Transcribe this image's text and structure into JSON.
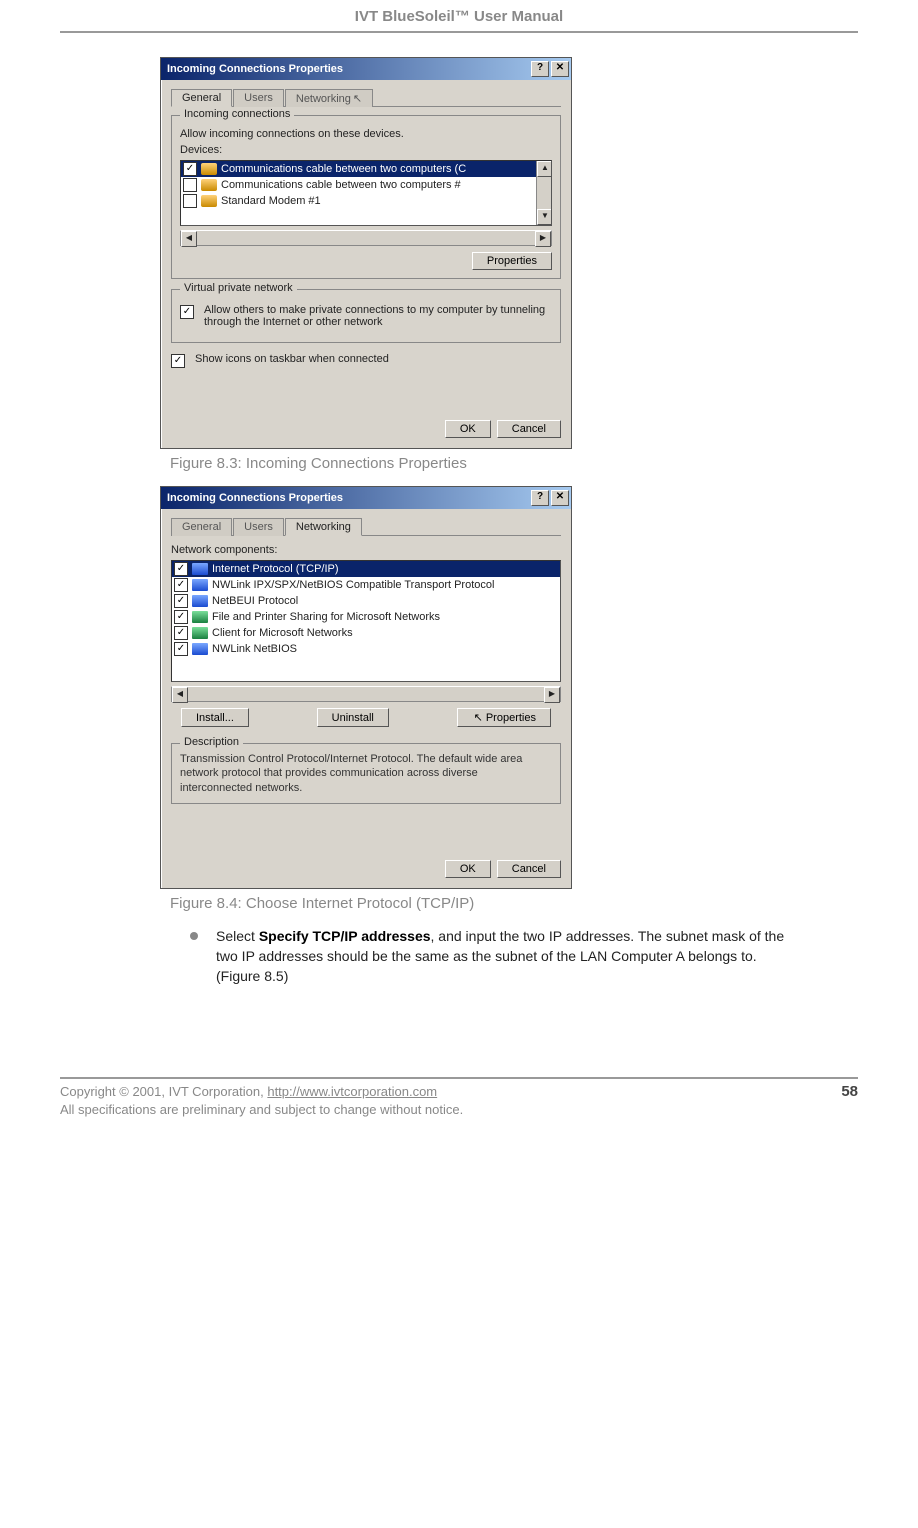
{
  "header": {
    "title": "IVT BlueSoleil™ User Manual"
  },
  "dialog1": {
    "title": "Incoming Connections Properties",
    "helpGlyph": "?",
    "closeGlyph": "✕",
    "tabs": {
      "general": "General",
      "users": "Users",
      "networking": "Networking"
    },
    "group1": {
      "legend": "Incoming connections",
      "intro": "Allow incoming connections on these devices.",
      "devicesLabel": "Devices:",
      "items": [
        "Communications cable between two computers (C",
        "Communications cable between two computers #",
        "Standard Modem #1"
      ],
      "scrollUp": "▲",
      "scrollDown": "▼",
      "hLeft": "◀",
      "hRight": "▶",
      "propertiesBtn": "Properties"
    },
    "group2": {
      "legend": "Virtual private network",
      "text": "Allow others to make private connections to my computer by tunneling through the Internet or other network"
    },
    "showIcons": "Show icons on taskbar when connected",
    "okBtn": "OK",
    "cancelBtn": "Cancel"
  },
  "caption1": "Figure 8.3: Incoming Connections Properties",
  "dialog2": {
    "title": "Incoming Connections Properties",
    "helpGlyph": "?",
    "closeGlyph": "✕",
    "tabs": {
      "general": "General",
      "users": "Users",
      "networking": "Networking"
    },
    "componentsLabel": "Network components:",
    "items": [
      "Internet Protocol (TCP/IP)",
      "NWLink IPX/SPX/NetBIOS Compatible Transport Protocol",
      "NetBEUI Protocol",
      "File and Printer Sharing for Microsoft Networks",
      "Client for Microsoft Networks",
      "NWLink NetBIOS"
    ],
    "hLeft": "◀",
    "hRight": "▶",
    "installBtn": "Install...",
    "uninstallBtn": "Uninstall",
    "propertiesBtn": "Properties",
    "descLegend": "Description",
    "descText": "Transmission Control Protocol/Internet Protocol. The default wide area network protocol that provides communication across diverse interconnected networks.",
    "okBtn": "OK",
    "cancelBtn": "Cancel"
  },
  "caption2": "Figure 8.4: Choose Internet Protocol (TCP/IP)",
  "bullet": {
    "prefix": "Select ",
    "boldPart": "Specify TCP/IP addresses",
    "rest": ", and input the two IP addresses. The subnet mask of the two IP addresses should be the same as the subnet of the LAN Computer A belongs to. (Figure 8.5)"
  },
  "footer": {
    "line1a": "Copyright © 2001, IVT Corporation, ",
    "line1b": "http://www.ivtcorporation.com",
    "line2": "All specifications are preliminary and subject to change without notice.",
    "pageNum": "58"
  }
}
